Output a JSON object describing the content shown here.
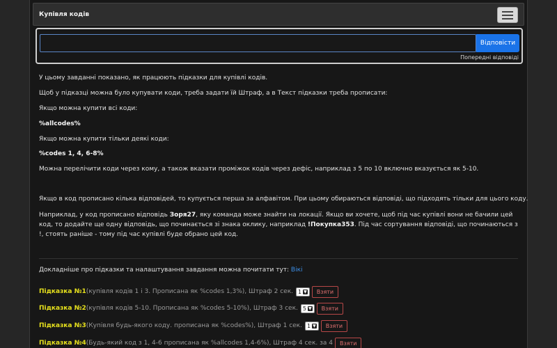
{
  "header": {
    "title": "Купівля кодів"
  },
  "answer": {
    "placeholder": "",
    "value": "",
    "send_label": "Відповісти",
    "prev_answers_label": "Попередні відповіді"
  },
  "text": {
    "p1": "У цьому завданні показано, як працюють підказки для купівлі кодів.",
    "p2": "Щоб у підказці можна було купувати коди, треба задати їй Штраф, а в Текст підказки треба прописати:",
    "p3": "Якщо можна купити всі коди:",
    "p4": "%allcodes%",
    "p5": "Якщо можна купити тільки деякі коди:",
    "p6": "%codes 1, 4, 6-8%",
    "p7": "Можна перелічити коди через кому, а також вказати проміжок кодів через дефіс, наприклад з 5 по 10 включно вказується як 5-10.",
    "p8": "Якщо в код прописано кілька відповідей, то купується перша за алфавітом. При цьому обираються відповіді, що підходять тільки для цього коду.",
    "p9_a": "Наприклад, у код прописано відповідь ",
    "p9_b1": "Зоря27",
    "p9_c": ", яку команда може знайти на локації. Якщо ви хочете, щоб під час купівлі вони не бачили цей код, то додайте ще одну відповідь, що починається зі знака оклику, наприклад ",
    "p9_b2": "!Покупка353",
    "p9_d": ". Під час сортування відповіді, що починаються з !, стоять раніше - тому під час купівлі буде обрано цей код.",
    "p10": "Докладніше про підказки та налаштування завдання можна почитати тут: ",
    "wiki_link": "Вікі"
  },
  "hints": [
    {
      "title": "Підказка №1",
      "desc": "(купівля кодів 1 і 3. Прописана як %codes 1,3%), Штраф 2 сек.",
      "selected": "1",
      "take_label": "Взяти"
    },
    {
      "title": "Підказка №2",
      "desc": "(купівля кодів 5-10. Прописана як %codes 5-10%), Штраф 3 сек.",
      "selected": "5",
      "take_label": "Взяти"
    },
    {
      "title": "Підказка №3",
      "desc": "(Купівля будь-якого коду. прописана як %codes%), Штраф 1 сек.",
      "selected": "1",
      "take_label": "Взяти"
    },
    {
      "title": "Підказка №4",
      "desc": "(Будь-який код з 1, 4-6 прописана як %allcodes 1,4-6%), Штраф 4 сек. за 4",
      "selected": "",
      "take_label": "Взяти"
    }
  ]
}
